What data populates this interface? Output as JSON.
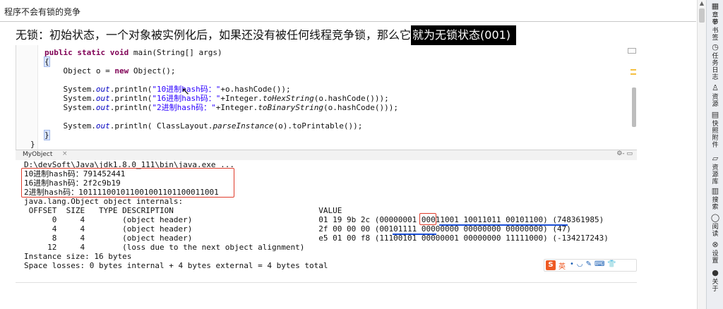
{
  "window": {
    "title": "程序不会有锁的竞争"
  },
  "heading": {
    "prefix": "无锁：初始状态，一个对象被实例化后，如果还没有被任何线程竞争锁，那么它",
    "highlight": "就为无锁状态(001)"
  },
  "code": {
    "line1_kw": "public static void",
    "line1_rest": " main(String[] args)",
    "line2": "{",
    "line3_a": "    Object o = ",
    "line3_kw": "new",
    "line3_b": " Object();",
    "line4": "",
    "line5_a": "    System.",
    "line5_out": "out",
    "line5_b": ".println(",
    "line5_str": "\"10进制hash码：\"",
    "line5_c": "+o.hashCode());",
    "line6_a": "    System.",
    "line6_out": "out",
    "line6_b": ".println(",
    "line6_str": "\"16进制hash码：\"",
    "line6_c": "+Integer.",
    "line6_m": "toHexString",
    "line6_d": "(o.hashCode()));",
    "line7_a": "    System.",
    "line7_out": "out",
    "line7_b": ".println(",
    "line7_str": "\"2进制hash码：\"",
    "line7_c": "+Integer.",
    "line7_m": "toBinaryString",
    "line7_d": "(o.hashCode()));",
    "line8": "",
    "line9_a": "    System.",
    "line9_out": "out",
    "line9_b": ".println( ClassLayout.",
    "line9_m": "parseInstance",
    "line9_c": "(o).toPrintable());",
    "line10": "}",
    "line11": "}"
  },
  "console_tab": {
    "label": "MyObject",
    "close": "×",
    "tools": "⚙- ▭"
  },
  "console": {
    "cmd": "D:\\devSoft\\Java\\jdk1.8.0_111\\bin\\java.exe ...",
    "hash10": "10进制hash码：791452441",
    "hash16": "16进制hash码：2f2c9b19",
    "hash2": "2进制hash码：101111001011001001101100011001",
    "internals": "java.lang.Object object internals:",
    "header": " OFFSET  SIZE   TYPE DESCRIPTION                               VALUE",
    "row1": "      0     4        (object header)                           01 19 9b 2c (00000001 00011001 10011011 00101100) (748361985)",
    "row2": "      4     4        (object header)                           2f 00 00 00 (00101111 00000000 00000000 00000000) (47)",
    "row3": "      8     4        (object header)                           e5 01 00 f8 (11100101 00000001 00000000 11111000) (-134217243)",
    "row4": "     12     4        (loss due to the next object alignment)",
    "size": "Instance size: 16 bytes",
    "losses": "Space losses: 0 bytes internal + 4 bytes external = 4 bytes total"
  },
  "ime": {
    "logo": "S",
    "lang": "英",
    "tools": "•◡✎⌨👕"
  },
  "sidebar": {
    "items": [
      {
        "icon": "▦",
        "label": "章节"
      },
      {
        "icon": "⊕",
        "label": "书签"
      },
      {
        "icon": "◷",
        "label": "任务日志"
      },
      {
        "icon": "♙",
        "label": "资源"
      },
      {
        "icon": "▤",
        "label": "快照附件"
      },
      {
        "icon": "▱",
        "label": "资源库"
      },
      {
        "icon": "▥",
        "label": "搜索"
      },
      {
        "icon": "◯",
        "label": "阅读"
      },
      {
        "icon": "⊗",
        "label": "设置"
      },
      {
        "icon": "●",
        "label": "关于"
      }
    ]
  },
  "colors": {
    "keyword": "#7f0055",
    "string": "#2a00ff",
    "field": "#0000c0",
    "annotation_red": "#e03b2a",
    "annotation_blue": "#1a4fd6",
    "highlight_bg": "#000000"
  }
}
